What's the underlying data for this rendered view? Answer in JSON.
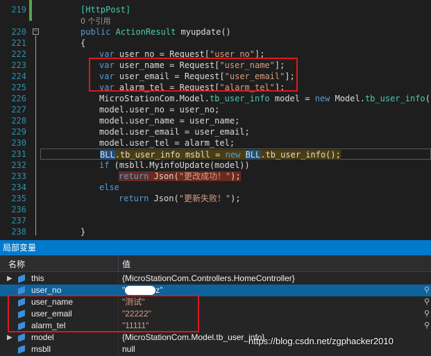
{
  "editor": {
    "line_numbers": [
      "219",
      "",
      "220",
      "221",
      "222",
      "223",
      "224",
      "225",
      "226",
      "227",
      "228",
      "229",
      "230",
      "231",
      "232",
      "233",
      "234",
      "235",
      "236",
      "237",
      "238"
    ],
    "lines": {
      "attr": "[HttpPost]",
      "refs": "0 个引用",
      "l220_kw1": "public",
      "l220_ty": "ActionResult",
      "l220_rest": " myupdate()",
      "l221": "{",
      "l222_kw": "var",
      "l222_rest": " user_no = Request[",
      "l222_str": "\"user_no\"",
      "l222_end": "];",
      "l223_kw": "var",
      "l223_rest": " user_name = Request[",
      "l223_str": "\"user_name\"",
      "l223_end": "];",
      "l224_kw": "var",
      "l224_rest": " user_email = Request[",
      "l224_str": "\"user_email\"",
      "l224_end": "];",
      "l225_kw": "var",
      "l225_rest": " alarm_tel = Request[",
      "l225_str": "\"alarm_tel\"",
      "l225_end": "];",
      "l226_a": "MicroStationCom.Model.",
      "l226_ty": "tb_user_info",
      "l226_b": " model = ",
      "l226_kw": "new",
      "l226_c": " Model.",
      "l226_ty2": "tb_user_info",
      "l226_d": "();",
      "l227": "model.user_no = user_no;",
      "l228": "model.user_name = user_name;",
      "l229": "model.user_email = user_email;",
      "l230": "model.user_tel = alarm_tel;",
      "l231_a": "BLL",
      "l231_b": ".tb_user_info msbll = ",
      "l231_kw": "new",
      "l231_c": " ",
      "l231_d": "BLL",
      "l231_e": ".tb_user_info();",
      "l232_kw": "if",
      "l232_rest": " (msbll.MyinfoUpdate(model))",
      "l233_kw": "return",
      "l233_rest": " Json(",
      "l233_str": "\"更改成功！\"",
      "l233_end": ");",
      "l234": "else",
      "l235_kw": "return",
      "l235_rest": " Json(",
      "l235_str": "\"更新失败！\"",
      "l235_end": ");",
      "l238": "}"
    }
  },
  "locals_panel": {
    "title": "局部变量",
    "col_name": "名称",
    "col_value": "值",
    "rows": [
      {
        "name": "this",
        "value": "{MicroStationCom.Controllers.HomeController}"
      },
      {
        "name": "user_no",
        "value_prefix": "\"",
        "value_suffix": "z\""
      },
      {
        "name": "user_name",
        "value": "\"测试\""
      },
      {
        "name": "user_email",
        "value": "\"22222\""
      },
      {
        "name": "alarm_tel",
        "value": "\"11111\""
      },
      {
        "name": "model",
        "value": "{MicroStationCom.Model.tb_user_info}"
      },
      {
        "name": "msbll",
        "value": "null"
      }
    ]
  },
  "watermark": "https://blog.csdn.net/zgphacker2010",
  "colors": {
    "keyword": "#569cd6",
    "type": "#4ec9b0",
    "string": "#d69d85",
    "line_number": "#2b91af",
    "highlight_box": "#e0161e",
    "panel_title": "#007acc"
  }
}
